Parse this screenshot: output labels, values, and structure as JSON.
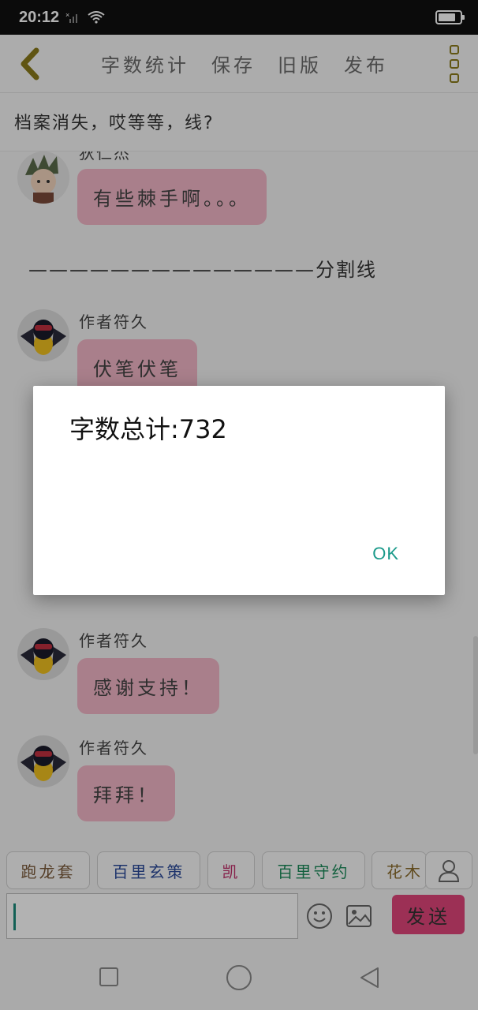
{
  "status": {
    "time": "20:12",
    "signal_icon": "signal-off-icon",
    "wifi_icon": "wifi-icon",
    "battery_level": 0.8
  },
  "topbar": {
    "back_icon": "chevron-left-icon",
    "menu": [
      "字数统计",
      "保存",
      "旧版",
      "发布"
    ],
    "more_icon": "more-vertical-icon"
  },
  "title": "档案消失，哎等等，线?",
  "messages": [
    {
      "name": "狄仁杰",
      "text": "有些棘手啊。。。",
      "avatar": "character-avatar"
    },
    {
      "divider": "——————————————分割线"
    },
    {
      "name": "作者符久",
      "text": "伏笔伏笔",
      "avatar": "pikachu-avatar"
    },
    {
      "name": "作者符久",
      "text": "感谢支持！",
      "avatar": "pikachu-avatar"
    },
    {
      "name": "作者符久",
      "text": "拜拜！",
      "avatar": "pikachu-avatar"
    }
  ],
  "chips": [
    {
      "label": "跑龙套",
      "color": "#7a5a3a"
    },
    {
      "label": "百里玄策",
      "color": "#2a4a9a"
    },
    {
      "label": "凯",
      "color": "#c0306a"
    },
    {
      "label": "百里守约",
      "color": "#1a8a5a"
    },
    {
      "label": "花木",
      "color": "#8a6a2a"
    }
  ],
  "input": {
    "value": "",
    "send_label": "发送"
  },
  "dialog": {
    "message": "字数总计:732",
    "ok_label": "OK"
  },
  "colors": {
    "accent": "#1a9a8a",
    "bubble": "#f2b7c7",
    "send": "#e0457a",
    "icon_gold": "#8a7a1a"
  }
}
